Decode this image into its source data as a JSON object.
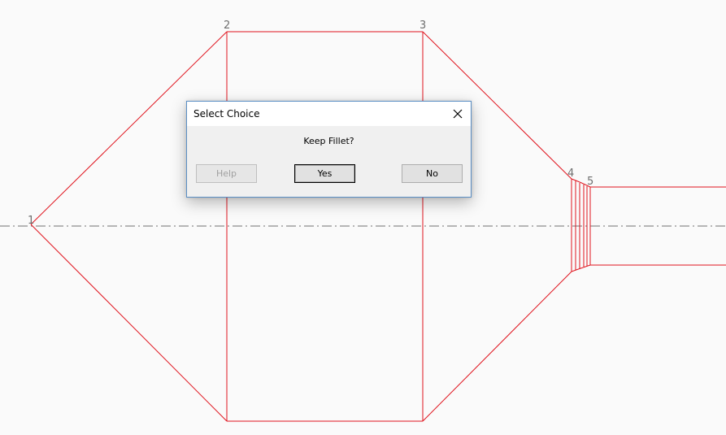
{
  "drawing": {
    "vertex_labels": [
      "1",
      "2",
      "3",
      "4",
      "5"
    ],
    "line_color": "#e0141e",
    "centerline_color": "#707070"
  },
  "dialog": {
    "title": "Select Choice",
    "message": "Keep Fillet?",
    "buttons": {
      "help": "Help",
      "yes": "Yes",
      "no": "No"
    },
    "close_icon": "close-icon",
    "accent_border": "#5a8ec4"
  }
}
